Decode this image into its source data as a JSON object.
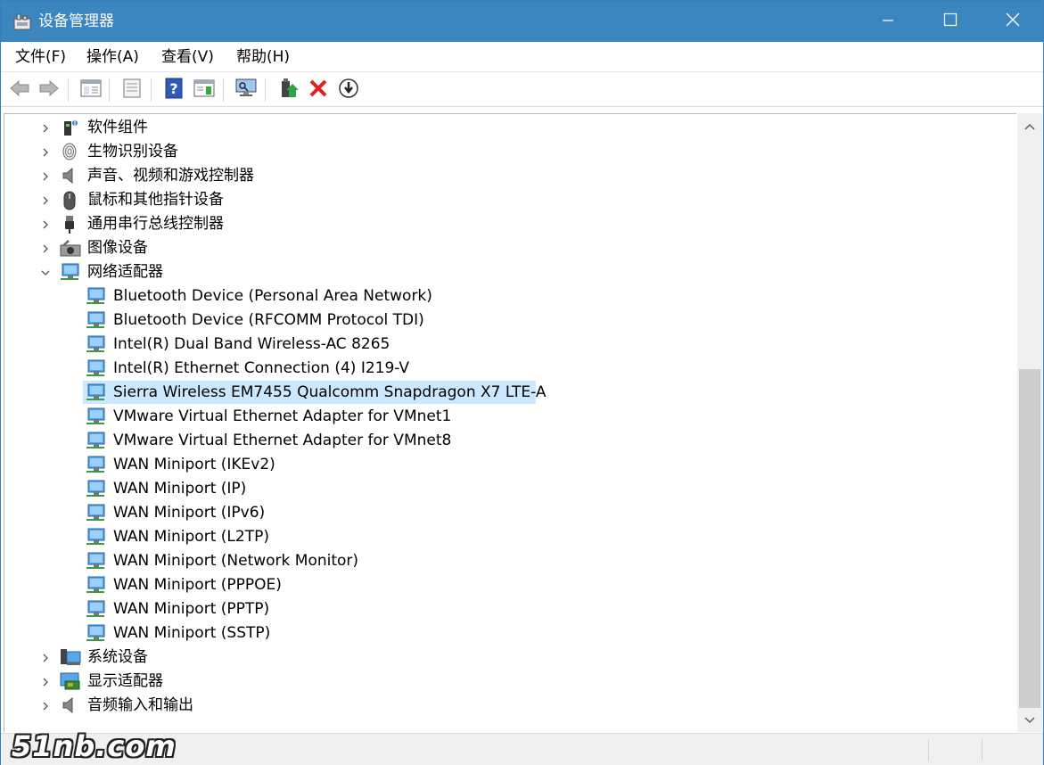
{
  "window": {
    "title": "设备管理器",
    "app_icon": "device-manager-icon",
    "controls": {
      "minimize": "minimize-icon",
      "maximize": "maximize-icon",
      "close": "close-icon"
    }
  },
  "menu": {
    "items": [
      {
        "label": "文件(F)"
      },
      {
        "label": "操作(A)"
      },
      {
        "label": "查看(V)"
      },
      {
        "label": "帮助(H)"
      }
    ]
  },
  "toolbar": {
    "buttons": [
      "back-icon",
      "forward-icon",
      "show-hide-console-tree-icon",
      "properties-icon",
      "help-icon",
      "action-pane-icon",
      "scan-hardware-icon",
      "update-driver-icon",
      "uninstall-device-icon",
      "disable-device-icon"
    ]
  },
  "tree": {
    "categories_top": [
      {
        "label": "软件组件",
        "icon": "software-component-icon",
        "expanded": false
      },
      {
        "label": "生物识别设备",
        "icon": "fingerprint-icon",
        "expanded": false
      },
      {
        "label": "声音、视频和游戏控制器",
        "icon": "speaker-icon",
        "expanded": false
      },
      {
        "label": "鼠标和其他指针设备",
        "icon": "mouse-icon",
        "expanded": false
      },
      {
        "label": "通用串行总线控制器",
        "icon": "usb-icon",
        "expanded": false
      },
      {
        "label": "图像设备",
        "icon": "camera-icon",
        "expanded": false
      },
      {
        "label": "网络适配器",
        "icon": "network-adapter-icon",
        "expanded": true
      }
    ],
    "network_adapters": [
      {
        "label": "Bluetooth Device (Personal Area Network)"
      },
      {
        "label": "Bluetooth Device (RFCOMM Protocol TDI)"
      },
      {
        "label": "Intel(R) Dual Band Wireless-AC 8265"
      },
      {
        "label": "Intel(R) Ethernet Connection (4) I219-V"
      },
      {
        "label": "Sierra Wireless EM7455 Qualcomm Snapdragon X7 LTE-A",
        "selected": true
      },
      {
        "label": "VMware Virtual Ethernet Adapter for VMnet1"
      },
      {
        "label": "VMware Virtual Ethernet Adapter for VMnet8"
      },
      {
        "label": "WAN Miniport (IKEv2)"
      },
      {
        "label": "WAN Miniport (IP)"
      },
      {
        "label": "WAN Miniport (IPv6)"
      },
      {
        "label": "WAN Miniport (L2TP)"
      },
      {
        "label": "WAN Miniport (Network Monitor)"
      },
      {
        "label": "WAN Miniport (PPPOE)"
      },
      {
        "label": "WAN Miniport (PPTP)"
      },
      {
        "label": "WAN Miniport (SSTP)"
      }
    ],
    "categories_bottom": [
      {
        "label": "系统设备",
        "icon": "system-device-icon",
        "expanded": false
      },
      {
        "label": "显示适配器",
        "icon": "display-adapter-icon",
        "expanded": false
      },
      {
        "label": "音频输入和输出",
        "icon": "audio-io-icon",
        "expanded": false
      }
    ]
  },
  "watermark": {
    "text": "51nb.com"
  },
  "colors": {
    "titlebar": "#3c86bf",
    "selection": "#cce8ff",
    "scrollbar_track": "#f0f0f0",
    "scrollbar_thumb": "#cdcdcd"
  }
}
